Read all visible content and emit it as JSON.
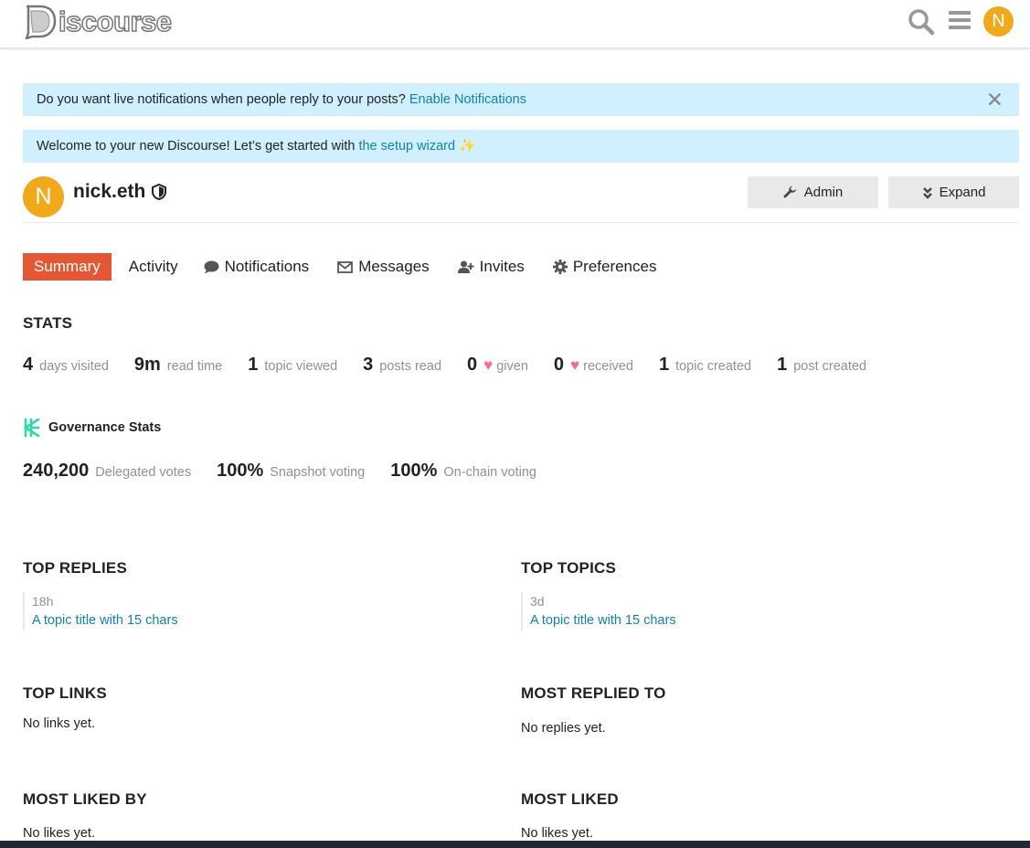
{
  "header": {
    "logo_text": "iscourse",
    "logo_letter": "D",
    "avatar_letter": "N"
  },
  "alerts": {
    "notifications_text": "Do you want live notifications when people reply to your posts? ",
    "notifications_link": "Enable Notifications",
    "close_glyph": "✕",
    "welcome_text": "Welcome to your new Discourse! Let’s get started with ",
    "welcome_link": "the setup wizard",
    "welcome_emoji": "✨"
  },
  "user": {
    "avatar_letter": "N",
    "username": "nick.eth",
    "admin_label": "Admin",
    "expand_label": "Expand"
  },
  "nav": {
    "summary": "Summary",
    "activity": "Activity",
    "notifications": "Notifications",
    "messages": "Messages",
    "invites": "Invites",
    "preferences": "Preferences"
  },
  "stats": {
    "title": "STATS",
    "items": [
      {
        "value": "4",
        "label": "days visited"
      },
      {
        "value": "9m",
        "label": "read time"
      },
      {
        "value": "1",
        "label": "topic viewed"
      },
      {
        "value": "3",
        "label": "posts read"
      },
      {
        "value": "0",
        "label": "given"
      },
      {
        "value": "0",
        "label": "received"
      },
      {
        "value": "1",
        "label": "topic created"
      },
      {
        "value": "1",
        "label": "post created"
      }
    ]
  },
  "governance": {
    "title": "Governance Stats",
    "items": [
      {
        "value": "240,200",
        "label": "Delegated votes"
      },
      {
        "value": "100%",
        "label": "Snapshot voting"
      },
      {
        "value": "100%",
        "label": "On-chain voting"
      }
    ]
  },
  "top_replies": {
    "title": "TOP REPLIES",
    "date": "18h",
    "link": "A topic title with 15 chars"
  },
  "top_topics": {
    "title": "TOP TOPICS",
    "date": "3d",
    "link": "A topic title with 15 chars"
  },
  "top_links": {
    "title": "TOP LINKS",
    "empty": "No links yet."
  },
  "most_replied_to": {
    "title": "MOST REPLIED TO",
    "empty": "No replies yet."
  },
  "most_liked_by": {
    "title": "MOST LIKED BY",
    "empty": "No likes yet."
  },
  "most_liked": {
    "title": "MOST LIKED",
    "empty": "No likes yet."
  },
  "colors": {
    "accent": "#e45735",
    "link": "#0f82af",
    "alert_bg": "#d1f0ff",
    "avatar": "#f0a91a",
    "heart": "#fa6c8d"
  },
  "icons": {
    "search": "search-icon",
    "menu": "hamburger-icon",
    "shield": "shield-icon",
    "wrench": "wrench-icon",
    "expand": "double-chevron-down-icon",
    "comment": "comment-icon",
    "envelope": "envelope-icon",
    "user_plus": "user-plus-icon",
    "gear": "gear-icon",
    "heart": "heart-icon",
    "governance": "governance-logo-icon"
  }
}
